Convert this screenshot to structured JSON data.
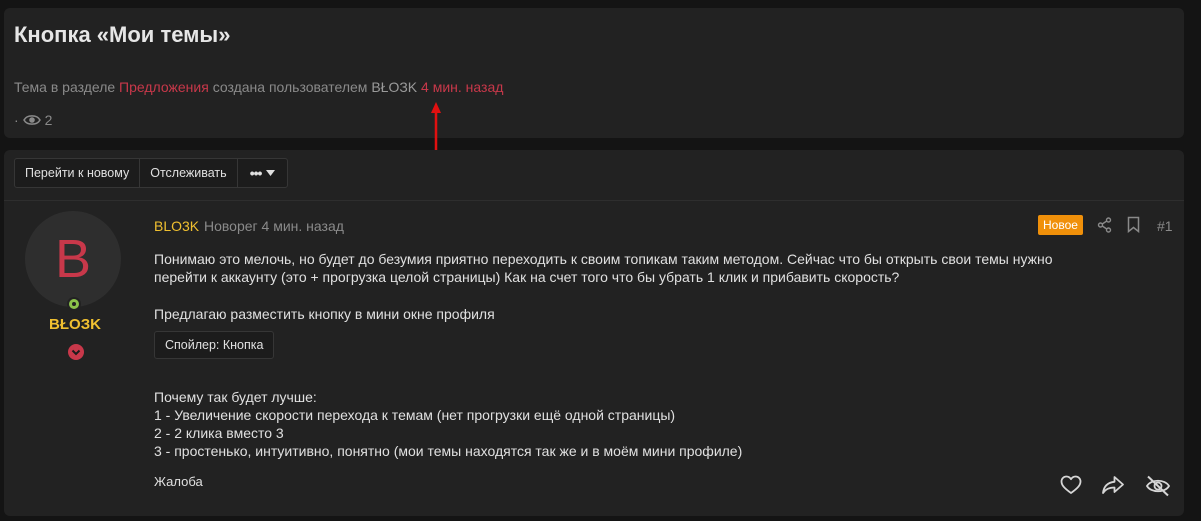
{
  "thread": {
    "title": "Кнопка «Мои темы»",
    "meta_prefix": "Тема в разделе",
    "forum_link": "Предложения",
    "meta_middle": "создана пользователем",
    "author": "BŁOЗK",
    "time_ago": "4 мин. назад",
    "views_prefix": "·",
    "views": "2"
  },
  "toolbar": {
    "goto_new": "Перейти к новому",
    "watch": "Отслеживать",
    "more": "•••"
  },
  "post": {
    "avatar_letter": "B",
    "side_username": "BŁOЗK",
    "username": "BLO3K",
    "role_time": "Новорег 4 мин. назад",
    "new_badge": "Новое",
    "number": "#1",
    "lines": [
      "Понимаю это мелочь, но будет до безумия приятно переходить к своим топикам таким методом. Сейчас что бы открыть свои темы нужно",
      "перейти к аккаунту (это + прогрузка целой страницы) Как на счет того что бы убрать 1 клик и прибавить скорость?",
      "Предлагаю разместить кнопку в мини окне профиля",
      "Почему так будет лучше:",
      "1 - Увеличение скорости перехода к темам (нет прогрузки ещё одной страницы)",
      "2 - 2 клика вместо 3",
      "3 - простенько, интуитивно, понятно (мои темы находятся так же и в моём мини профиле)"
    ],
    "spoiler": "Спойлер: Кнопка",
    "report": "Жалоба"
  },
  "colors": {
    "accent_red": "#c8384a",
    "username_gold": "#f0c030",
    "badge_orange": "#f0900a",
    "online_green": "#8bc34a",
    "annotation_arrow": "#e01010"
  }
}
